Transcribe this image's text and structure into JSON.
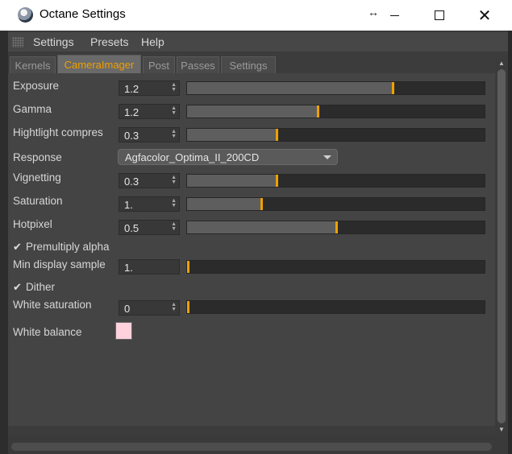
{
  "window": {
    "title": "Octane Settings",
    "icon": "cinema4d-icon",
    "resize_glyph": "↔",
    "close_glyph": "✕"
  },
  "menu": [
    "Settings",
    "Presets",
    "Help"
  ],
  "tabs": [
    {
      "label": "Kernels",
      "active": false
    },
    {
      "label": "CameraImager",
      "active": true
    },
    {
      "label": "Post",
      "active": false
    },
    {
      "label": "Passes",
      "active": false
    },
    {
      "label": "Settings",
      "active": false
    }
  ],
  "params": {
    "exposure": {
      "label": "Exposure",
      "value": "1.2",
      "slider_fraction": 0.69
    },
    "gamma": {
      "label": "Gamma",
      "value": "1.2",
      "slider_fraction": 0.44
    },
    "highlight": {
      "label": "Hightlight compres",
      "value": "0.3",
      "slider_fraction": 0.3
    },
    "response": {
      "label": "Response",
      "value": "Agfacolor_Optima_II_200CD"
    },
    "vignetting": {
      "label": "Vignetting",
      "value": "0.3",
      "slider_fraction": 0.3
    },
    "saturation": {
      "label": "Saturation",
      "value": "1.",
      "slider_fraction": 0.25
    },
    "hotpixel": {
      "label": "Hotpixel",
      "value": "0.5",
      "slider_fraction": 0.5
    },
    "premultiply": {
      "label": "Premultiply alpha",
      "checked": true
    },
    "min_display": {
      "label": "Min display sample",
      "value": "1.",
      "slider_fraction": 0.0
    },
    "dither": {
      "label": "Dither",
      "checked": true
    },
    "white_saturation": {
      "label": "White saturation",
      "value": "0",
      "slider_fraction": 0.0
    },
    "white_balance": {
      "label": "White balance",
      "color": "#ffd1dc"
    }
  },
  "icons": {
    "check": "✔",
    "spin": "▲▼",
    "scroll_up": "▲",
    "scroll_down": "▼"
  },
  "colors": {
    "accent": "#f0a000",
    "panel": "#444444",
    "slider_fill": "#5e5e5e"
  }
}
